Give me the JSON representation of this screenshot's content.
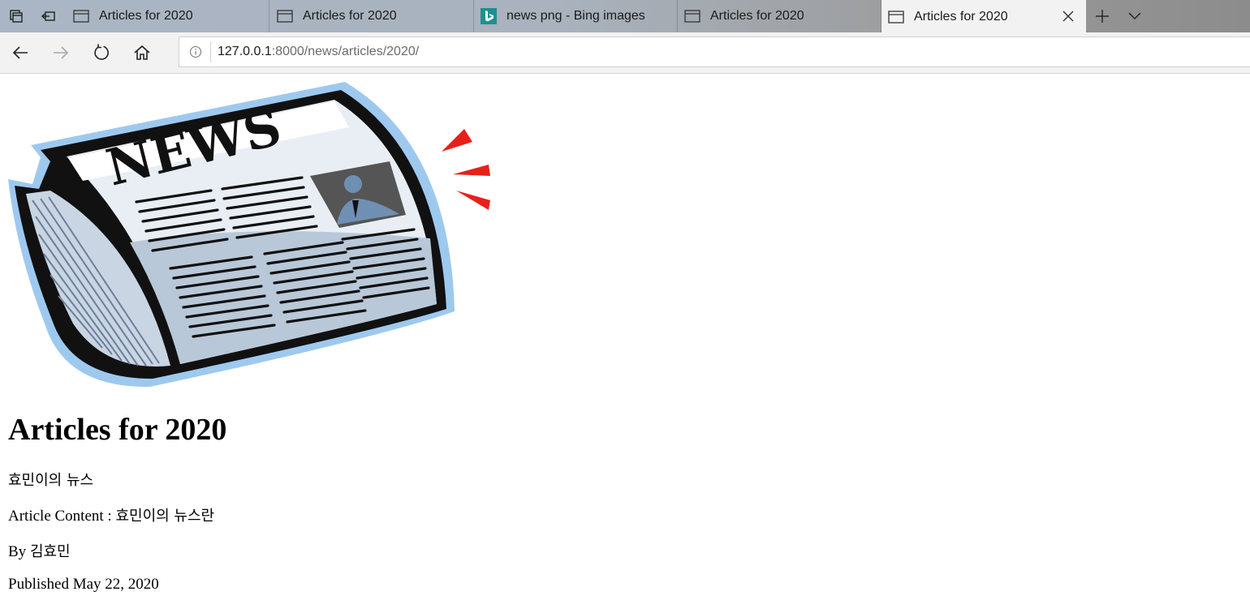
{
  "browser": {
    "tabs": [
      {
        "title": "Articles for 2020",
        "icon": "page-icon",
        "active": false
      },
      {
        "title": "Articles for 2020",
        "icon": "page-icon",
        "active": false
      },
      {
        "title": "news png - Bing images",
        "icon": "bing-icon",
        "active": false
      },
      {
        "title": "Articles for 2020",
        "icon": "page-icon",
        "active": false
      },
      {
        "title": "Articles for 2020",
        "icon": "page-icon",
        "active": true
      }
    ],
    "address": {
      "host": "127.0.0.1",
      "rest": ":8000/news/articles/2020/"
    },
    "colors": {
      "tabstrip": "#aab6c6",
      "toolbar": "#f2f2f2",
      "bing": "#1f8f8f"
    }
  },
  "page": {
    "image_logo_text": "NEWS",
    "heading": "Articles for 2020",
    "article_title": "효민이의 뉴스",
    "content_label": "Article Content : ",
    "content_value": "효민이의 뉴스란",
    "byline_label": "By ",
    "byline_author": "김효민",
    "published": "Published May 22, 2020"
  }
}
